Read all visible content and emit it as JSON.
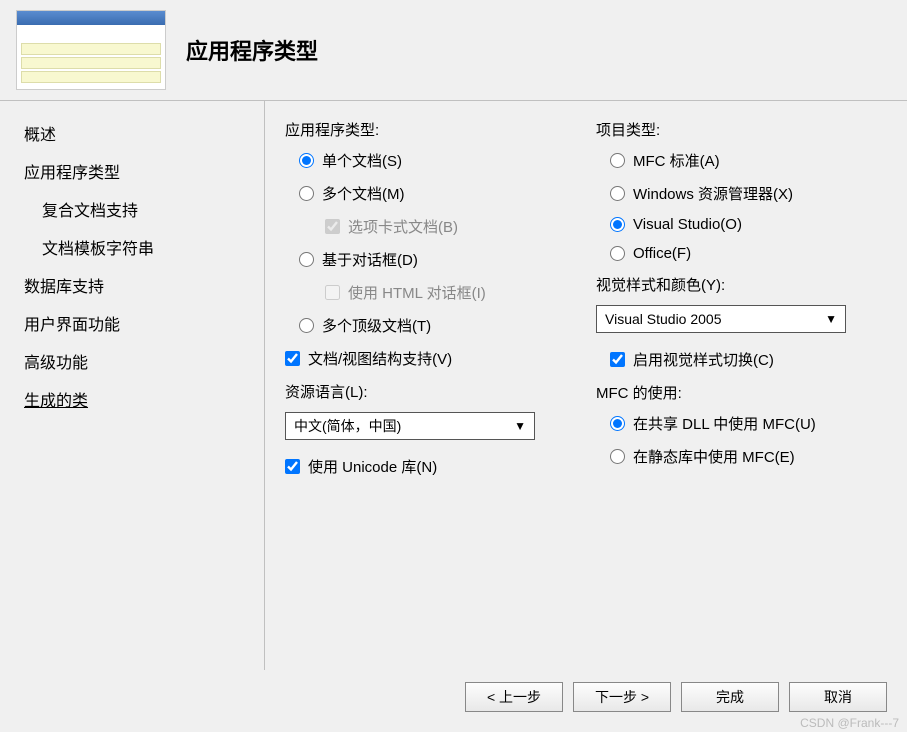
{
  "header": {
    "title": "应用程序类型"
  },
  "sidebar": {
    "items": [
      {
        "label": "概述",
        "indent": 0
      },
      {
        "label": "应用程序类型",
        "indent": 0
      },
      {
        "label": "复合文档支持",
        "indent": 1
      },
      {
        "label": "文档模板字符串",
        "indent": 1
      },
      {
        "label": "数据库支持",
        "indent": 0
      },
      {
        "label": "用户界面功能",
        "indent": 0
      },
      {
        "label": "高级功能",
        "indent": 0
      },
      {
        "label": "生成的类",
        "indent": 0,
        "linked": true
      }
    ]
  },
  "left": {
    "app_type_label": "应用程序类型:",
    "single_doc": "单个文档(S)",
    "multi_doc": "多个文档(M)",
    "tabbed_doc": "选项卡式文档(B)",
    "dialog_based": "基于对话框(D)",
    "html_dialog": "使用 HTML 对话框(I)",
    "multi_top": "多个顶级文档(T)",
    "doc_view": "文档/视图结构支持(V)",
    "res_lang_label": "资源语言(L):",
    "res_lang_value": "中文(简体，中国)",
    "unicode": "使用 Unicode 库(N)"
  },
  "right": {
    "proj_type_label": "项目类型:",
    "mfc_std": "MFC 标准(A)",
    "win_explorer": "Windows 资源管理器(X)",
    "visual_studio": "Visual Studio(O)",
    "office": "Office(F)",
    "visual_style_label": "视觉样式和颜色(Y):",
    "visual_style_value": "Visual Studio 2005",
    "enable_switch": "启用视觉样式切换(C)",
    "mfc_use_label": "MFC 的使用:",
    "shared_dll": "在共享 DLL 中使用 MFC(U)",
    "static_lib": "在静态库中使用 MFC(E)"
  },
  "footer": {
    "prev": "< 上一步",
    "next": "下一步 >",
    "finish": "完成",
    "cancel": "取消"
  },
  "watermark": "CSDN @Frank---7"
}
